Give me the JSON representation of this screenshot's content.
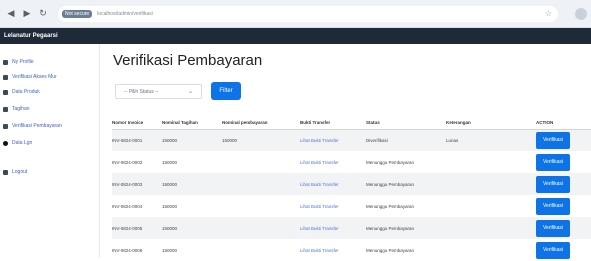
{
  "browser": {
    "back_icon": "arrow-left-icon",
    "forward_icon": "arrow-right-icon",
    "reload_icon": "reload-icon",
    "url_tag": "Not secure",
    "url": "localhost/admin/verifikasi"
  },
  "app": {
    "brand": "Lelanatur Pegaarsi"
  },
  "sidebar": {
    "items": [
      {
        "label": "Ny Profile",
        "icon": "user-icon"
      },
      {
        "label": "Verifikasi Akses Mur",
        "icon": "list-icon"
      },
      {
        "label": "Data Produk",
        "icon": "box-icon"
      },
      {
        "label": "Tagihan",
        "icon": "document-icon"
      },
      {
        "label": "Verifikasi Pembayaran",
        "icon": "check-icon"
      },
      {
        "label": "Data Lgn",
        "icon": "dot-icon"
      },
      {
        "label": "Logout",
        "icon": "logout-icon"
      }
    ]
  },
  "main": {
    "title": "Verifikasi Pembayaran",
    "filter": {
      "select_value": "-- Pilih Status --",
      "button_label": "Filter"
    },
    "table": {
      "headers": [
        "Nomor Invoice",
        "Nominal Tagihan",
        "Nominal pembayaran",
        "Bukti Transfer",
        "Status",
        "Keterangan",
        "ACTION"
      ],
      "rows": [
        {
          "invoice": "INV-0824-0001",
          "tagihan": "150000",
          "pembayaran": "150000",
          "bukti": "Lihat Bukti Transfer",
          "status": "Diverifikasi",
          "keterangan": "Lunas",
          "action": "Verifikasi"
        },
        {
          "invoice": "INV-0824-0002",
          "tagihan": "150000",
          "pembayaran": "",
          "bukti": "Lihat Bukti Transfer",
          "status": "Menunggu Pembayaran",
          "keterangan": "",
          "action": "Verifikasi"
        },
        {
          "invoice": "INV-0824-0003",
          "tagihan": "150000",
          "pembayaran": "",
          "bukti": "Lihat Bukti Transfer",
          "status": "Menunggu Pembayaran",
          "keterangan": "",
          "action": "Verifikasi"
        },
        {
          "invoice": "INV-0824-0004",
          "tagihan": "150000",
          "pembayaran": "",
          "bukti": "Lihat Bukti Transfer",
          "status": "Menunggu Pembayaran",
          "keterangan": "",
          "action": "Verifikasi"
        },
        {
          "invoice": "INV-0824-0005",
          "tagihan": "150000",
          "pembayaran": "",
          "bukti": "Lihat Bukti Transfer",
          "status": "Menunggu Pembayaran",
          "keterangan": "",
          "action": "Verifikasi"
        },
        {
          "invoice": "INV-0824-0006",
          "tagihan": "150000",
          "pembayaran": "",
          "bukti": "Lihat Bukti Transfer",
          "status": "Menunggu Pembayaran",
          "keterangan": "",
          "action": "Verifikasi"
        }
      ]
    }
  },
  "colors": {
    "primary": "#0d73e6",
    "header_bg": "#1f2a38",
    "link": "#4d78d6"
  }
}
